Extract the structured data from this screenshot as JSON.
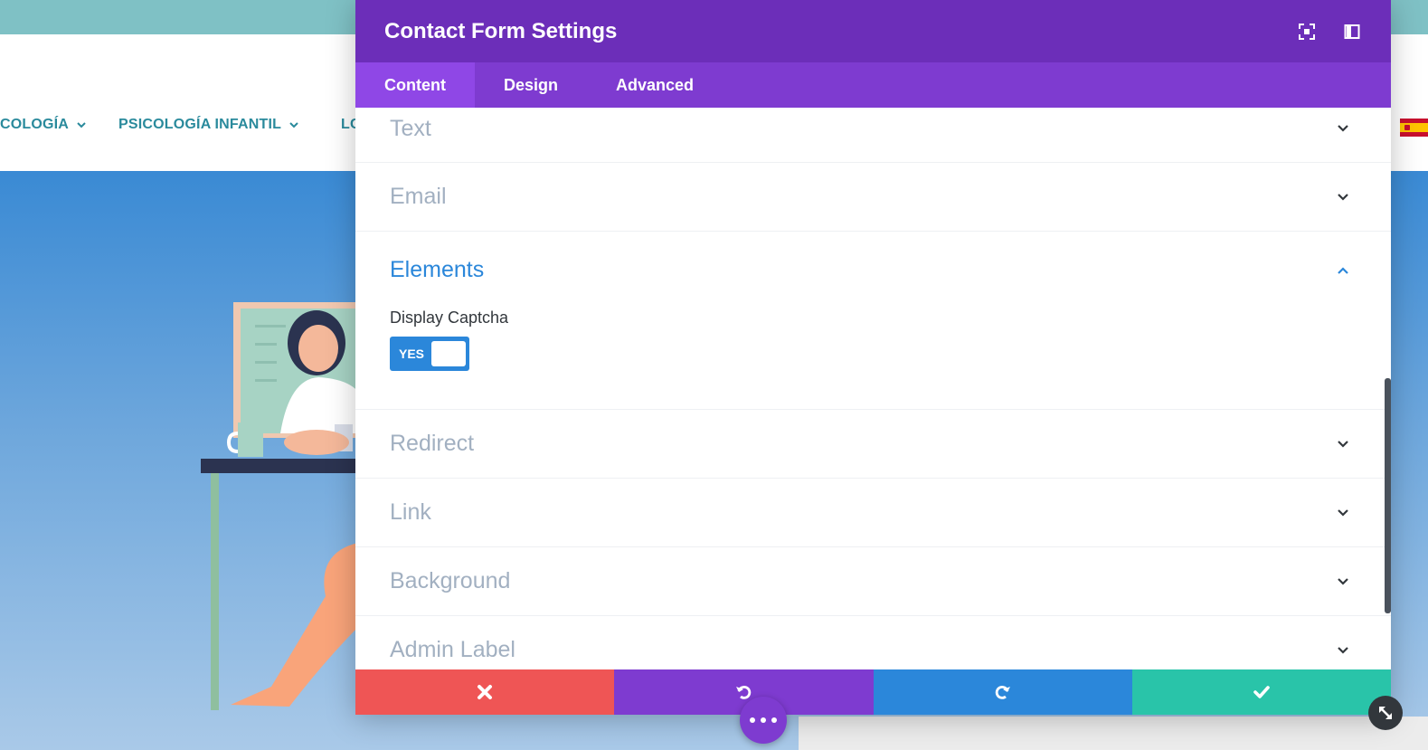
{
  "site": {
    "nav": [
      {
        "label": "COLOGÍA"
      },
      {
        "label": "PSICOLOGÍA INFANTIL"
      },
      {
        "label": "LC"
      }
    ],
    "flag_icon": "spain-flag-icon",
    "colors": {
      "topbar": "#7fc1c5",
      "nav_text": "#2a8a9c",
      "hero": "#3a8ad4"
    }
  },
  "modal": {
    "title": "Contact Form Settings",
    "header_icons": [
      "fullscreen-icon",
      "sidebar-toggle-icon"
    ],
    "tabs": [
      {
        "label": "Content",
        "active": true
      },
      {
        "label": "Design",
        "active": false
      },
      {
        "label": "Advanced",
        "active": false
      }
    ],
    "sections": {
      "text": "Text",
      "email": "Email",
      "elements": {
        "title": "Elements",
        "display_captcha_label": "Display Captcha",
        "toggle_value": "YES"
      },
      "redirect": "Redirect",
      "link": "Link",
      "background": "Background",
      "admin_label": "Admin Label"
    },
    "footer": {
      "cancel_icon": "close-icon",
      "undo_icon": "undo-icon",
      "redo_icon": "redo-icon",
      "save_icon": "check-icon"
    },
    "colors": {
      "header": "#6c2eb9",
      "tabs": "#7e3bd0",
      "active_tab": "#8f47e6",
      "accent": "#2b87da",
      "cancel": "#ef5555",
      "save": "#29c4a9"
    }
  }
}
